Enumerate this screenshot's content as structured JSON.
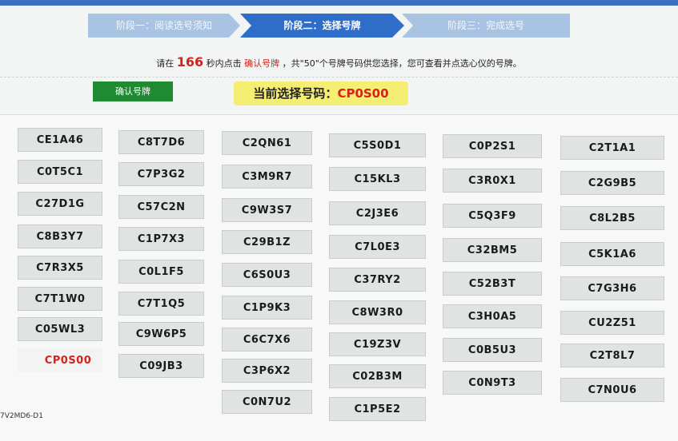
{
  "steps": [
    {
      "label": "阶段一：阅读选号须知"
    },
    {
      "label": "阶段二：选择号牌"
    },
    {
      "label": "阶段三：完成选号"
    }
  ],
  "notice": {
    "prefix": "请在",
    "seconds": "166",
    "middle": "秒内点击",
    "highlight": "确认号牌",
    "suffix": "，共\"50\"个号牌号码供您选择，您可查看并点选心仪的号牌。"
  },
  "confirm_button": {
    "label": "确认号牌"
  },
  "current_selection": {
    "label": "当前选择号码：",
    "code": "CP0S00"
  },
  "plates": [
    {
      "code": "CE1A46"
    },
    {
      "code": "C0T5C1"
    },
    {
      "code": "C27D1G"
    },
    {
      "code": "C8B3Y7"
    },
    {
      "code": "C7R3X5"
    },
    {
      "code": "C7T1W0"
    },
    {
      "code": "C05WL3"
    },
    {
      "code": "CP0S00",
      "selected": true
    },
    {
      "code": "C8T7D6"
    },
    {
      "code": "C7P3G2"
    },
    {
      "code": "C57C2N"
    },
    {
      "code": "C1P7X3"
    },
    {
      "code": "C0L1F5"
    },
    {
      "code": "C7T1Q5"
    },
    {
      "code": "C9W6P5"
    },
    {
      "code": "C09JB3"
    },
    {
      "code": "C2QN61"
    },
    {
      "code": "C3M9R7"
    },
    {
      "code": "C9W3S7"
    },
    {
      "code": "C29B1Z"
    },
    {
      "code": "C6S0U3"
    },
    {
      "code": "C1P9K3"
    },
    {
      "code": "C6C7X6"
    },
    {
      "code": "C3P6X2"
    },
    {
      "code": "C0N7U2"
    },
    {
      "code": "C5S0D1"
    },
    {
      "code": "C15KL3"
    },
    {
      "code": "C2J3E6"
    },
    {
      "code": "C7L0E3"
    },
    {
      "code": "C37RY2"
    },
    {
      "code": "C8W3R0"
    },
    {
      "code": "C19Z3V"
    },
    {
      "code": "C02B3M"
    },
    {
      "code": "C1P5E2"
    },
    {
      "code": "C0P2S1"
    },
    {
      "code": "C3R0X1"
    },
    {
      "code": "C5Q3F9"
    },
    {
      "code": "C32BM5"
    },
    {
      "code": "C52B3T"
    },
    {
      "code": "C3H0A5"
    },
    {
      "code": "C0B5U3"
    },
    {
      "code": "C0N9T3"
    },
    {
      "code": "C2T1A1"
    },
    {
      "code": "C2G9B5"
    },
    {
      "code": "C8L2B5"
    },
    {
      "code": "C5K1A6"
    },
    {
      "code": "C7G3H6"
    },
    {
      "code": "CU2Z51"
    },
    {
      "code": "C2T8L7"
    },
    {
      "code": "C7N0U6"
    }
  ],
  "footer": {
    "text": "7V2MD6-D1"
  }
}
